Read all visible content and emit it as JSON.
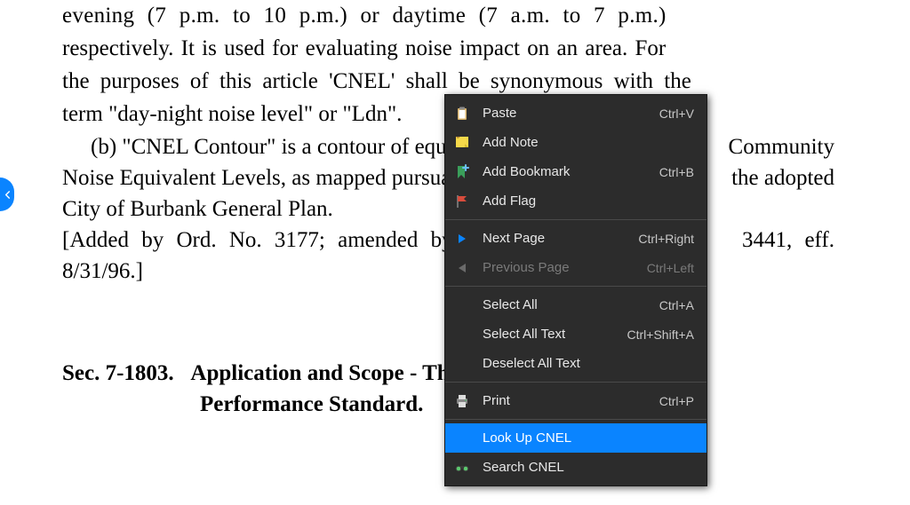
{
  "doc": {
    "para1_l1": "evening (7 p.m. to 10 p.m.) or daytime (7 a.m. to 7 p.m.)",
    "para1_l2": "respectively.  It is used for evaluating noise impact on an area.  For",
    "para1_l3a": "the purposes of this article '",
    "para1_l3b_sel": "CNEL",
    "para1_l3c": "' shall be synonymous with the",
    "para1_l4": "term \"day-night noise level\" or \"Ldn\".",
    "para2_l1_left": "(b)   \"CNEL Contour\" is a contour of equal",
    "para2_l1_right": "Community",
    "para2_l2_left": "Noise Equivalent Levels, as mapped pursuant to",
    "para2_l2_right": "the adopted",
    "para2_l3": "City of Burbank General Plan.",
    "bracket_l1_left": "[Added  by  Ord.  No.  3177;  amended  by  Ord.  No.",
    "bracket_l1_right": "3441,  eff.",
    "bracket_l2": "8/31/96.]",
    "section_no": "Sec. 7-1803.",
    "section_title_1": "Application and Scope - The Application",
    "section_title_2": "Performance Standard."
  },
  "ctx": {
    "paste": "Paste",
    "paste_sc": "Ctrl+V",
    "add_note": "Add Note",
    "add_bookmark": "Add Bookmark",
    "add_bookmark_sc": "Ctrl+B",
    "add_flag": "Add Flag",
    "next_page": "Next Page",
    "next_page_sc": "Ctrl+Right",
    "prev_page": "Previous Page",
    "prev_page_sc": "Ctrl+Left",
    "select_all": "Select All",
    "select_all_sc": "Ctrl+A",
    "select_all_text": "Select All Text",
    "select_all_text_sc": "Ctrl+Shift+A",
    "deselect_all_text": "Deselect All Text",
    "print": "Print",
    "print_sc": "Ctrl+P",
    "look_up": "Look Up CNEL",
    "search": "Search CNEL"
  }
}
